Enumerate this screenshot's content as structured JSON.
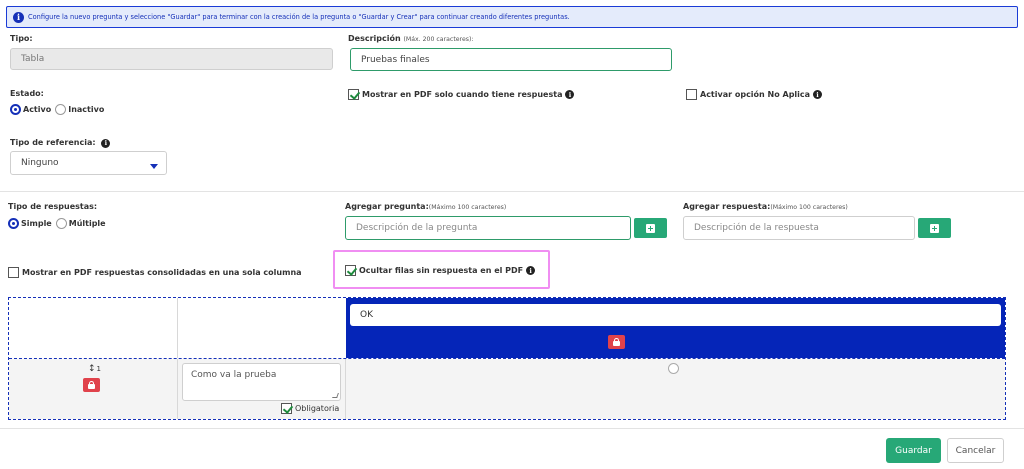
{
  "banner": {
    "text": "Configure la nuevo pregunta y seleccione \"Guardar\" para terminar con la creación de la pregunta o \"Guardar y Crear\" para continuar creando diferentes preguntas."
  },
  "tipo": {
    "label": "Tipo:",
    "value": "Tabla"
  },
  "descripcion": {
    "label": "Descripción",
    "hint": "(Máx. 200 caracteres):",
    "value": "Pruebas finales"
  },
  "estado": {
    "label": "Estado:",
    "options": [
      "Activo",
      "Inactivo"
    ],
    "selected": "Activo"
  },
  "mostrar_pdf": {
    "label": "Mostrar en PDF solo cuando tiene respuesta",
    "checked": true
  },
  "no_aplica": {
    "label": "Activar opción No Aplica",
    "checked": false
  },
  "tipo_referencia": {
    "label": "Tipo de referencia:",
    "value": "Ninguno"
  },
  "tipo_respuestas": {
    "label": "Tipo de respuestas:",
    "options": [
      "Simple",
      "Múltiple"
    ],
    "selected": "Simple"
  },
  "agregar_pregunta": {
    "label": "Agregar pregunta:",
    "hint": "(Máximo 100 caracteres)",
    "placeholder": "Descripción de la pregunta"
  },
  "agregar_respuesta": {
    "label": "Agregar respuesta:",
    "hint": "(Máximo 100 caracteres)",
    "placeholder": "Descripción de la respuesta"
  },
  "consolidadas": {
    "label": "Mostrar en PDF respuestas consolidadas en una sola columna",
    "checked": false
  },
  "ocultar_filas": {
    "label": "Ocultar filas sin respuesta en el PDF",
    "checked": true
  },
  "grid": {
    "answer_header": "OK",
    "row": {
      "order": "1",
      "question": "Como va la prueba",
      "required_label": "Obligatoria",
      "required_checked": true
    }
  },
  "footer": {
    "save": "Guardar",
    "cancel": "Cancelar"
  },
  "colors": {
    "primary": "#1530b8",
    "grid_header": "#0525b8",
    "green": "#27a877",
    "lock_red": "#e0424b",
    "highlight": "#f08ef2"
  }
}
